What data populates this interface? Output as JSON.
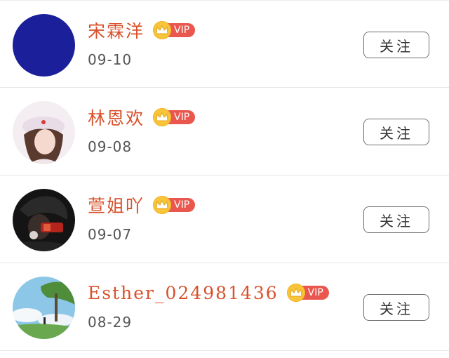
{
  "follow_list": {
    "items": [
      {
        "username": "宋霖洋",
        "badge": "VIP",
        "date": "09-10",
        "follow_label": "关注",
        "avatar": {
          "type": "solid",
          "color": "#1c1f9a"
        }
      },
      {
        "username": "林恩欢",
        "badge": "VIP",
        "date": "09-08",
        "follow_label": "关注",
        "avatar": {
          "type": "photo",
          "description": "girl-beret-photo"
        }
      },
      {
        "username": "萱姐吖",
        "badge": "VIP",
        "date": "09-07",
        "follow_label": "关注",
        "avatar": {
          "type": "photo",
          "description": "boy-dark-photo"
        }
      },
      {
        "username": "Esther_024981436",
        "badge": "VIP",
        "date": "08-29",
        "follow_label": "关注",
        "avatar": {
          "type": "photo",
          "description": "landscape-tree-sky-photo"
        }
      }
    ]
  },
  "colors": {
    "username": "#d8512b",
    "vip_bg": "#e9574f",
    "crown": "#f8c43a",
    "date": "#555555",
    "button_border": "#707070"
  }
}
